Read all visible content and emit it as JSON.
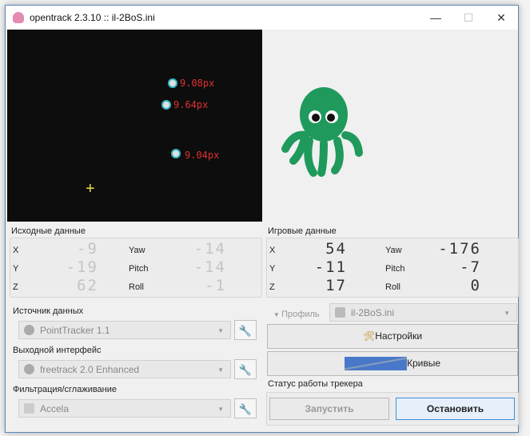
{
  "window": {
    "title": "opentrack 2.3.10 :: il-2BoS.ini",
    "minimize": "—",
    "maximize": "☐",
    "close": "✕"
  },
  "camera": {
    "points": [
      {
        "label": "9.08px"
      },
      {
        "label": "9.64px"
      },
      {
        "label": "9.04px"
      }
    ]
  },
  "raw": {
    "title": "Исходные данные",
    "rows": [
      {
        "axis": "X",
        "value": "-9",
        "rot": "Yaw",
        "rot_value": "-14"
      },
      {
        "axis": "Y",
        "value": "-19",
        "rot": "Pitch",
        "rot_value": "-14"
      },
      {
        "axis": "Z",
        "value": "62",
        "rot": "Roll",
        "rot_value": "-1"
      }
    ]
  },
  "game": {
    "title": "Игровые данные",
    "rows": [
      {
        "axis": "X",
        "value": "54",
        "rot": "Yaw",
        "rot_value": "-176"
      },
      {
        "axis": "Y",
        "value": "-11",
        "rot": "Pitch",
        "rot_value": "-7"
      },
      {
        "axis": "Z",
        "value": "17",
        "rot": "Roll",
        "rot_value": "0"
      }
    ]
  },
  "source": {
    "label": "Источник данных",
    "value": "PointTracker 1.1"
  },
  "output": {
    "label": "Выходной интерфейс",
    "value": "freetrack 2.0 Enhanced"
  },
  "filter": {
    "label": "Фильтрация/сглаживание",
    "value": "Accela"
  },
  "profile": {
    "label": "Профиль",
    "value": "il-2BoS.ini"
  },
  "buttons": {
    "settings": "Настройки",
    "curves": "Кривые",
    "start": "Запустить",
    "stop": "Остановить"
  },
  "status": {
    "label": "Статус работы трекера"
  }
}
